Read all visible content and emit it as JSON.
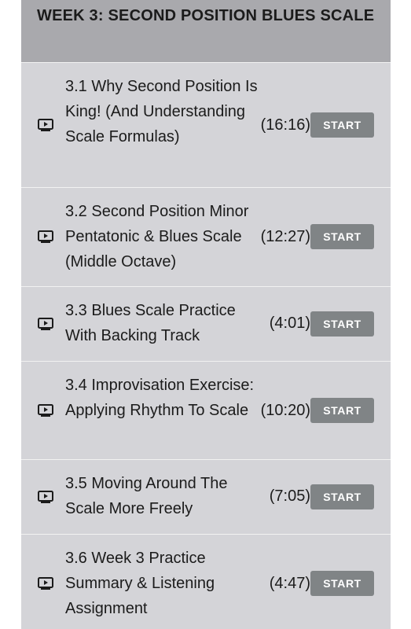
{
  "week": {
    "title": "WEEK 3: SECOND POSITION BLUES SCALE"
  },
  "lessons": [
    {
      "title": "3.1 Why Second Position Is King! (And Understanding Scale Formulas)",
      "duration": "(16:16)",
      "button": "START",
      "icon": "video-play-icon"
    },
    {
      "title": "3.2 Second Position Minor Pentatonic & Blues Scale (Middle Octave)",
      "duration": "(12:27)",
      "button": "START",
      "icon": "video-play-icon"
    },
    {
      "title": "3.3 Blues Scale Practice With Backing Track",
      "duration": "(4:01)",
      "button": "START",
      "icon": "video-play-icon"
    },
    {
      "title": "3.4 Improvisation Exercise: Applying Rhythm To Scale",
      "duration": "(10:20)",
      "button": "START",
      "icon": "video-play-icon"
    },
    {
      "title": "3.5 Moving Around The Scale More Freely",
      "duration": "(7:05)",
      "button": "START",
      "icon": "video-play-icon"
    },
    {
      "title": "3.6 Week 3 Practice Summary & Listening Assignment",
      "duration": "(4:47)",
      "button": "START",
      "icon": "video-play-icon"
    }
  ],
  "colors": {
    "header_bg": "#a9a9ad",
    "row_bg": "#d4d4d8",
    "button_bg": "#808486",
    "button_text": "#ffffff",
    "text": "#1b1b1b",
    "divider": "#f2f2f2"
  }
}
